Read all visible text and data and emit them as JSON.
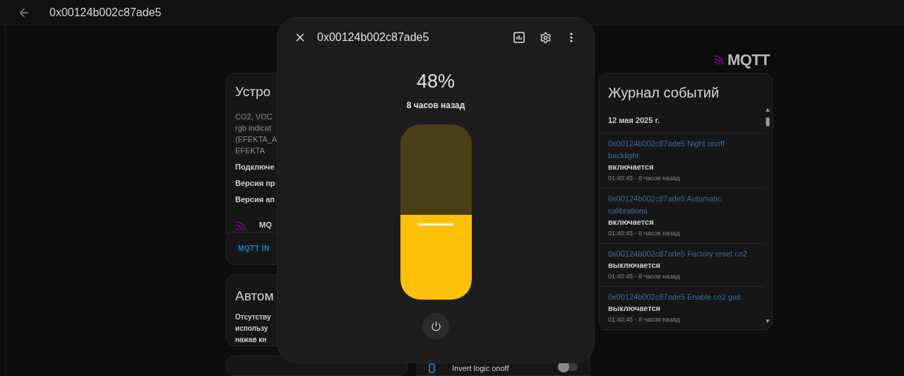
{
  "top_bar": {
    "title": "0x00124b002c87ade5"
  },
  "device_card": {
    "title": "Устро",
    "description_lines": [
      "CO2, VOC",
      "rgb indicat",
      "(EFEKTA_A",
      "EFEKTA"
    ],
    "info_lines": [
      "Подключе",
      "Версия пр",
      "Версия ап"
    ],
    "integration": "MQ",
    "action": "MQTT IN"
  },
  "automation_card": {
    "title": "Автом",
    "text_lines": [
      "Отсутству",
      "использу",
      "нажав кн"
    ]
  },
  "bottom_row": {
    "label": "Invert logic onoff",
    "on": false
  },
  "logo": {
    "text": "MQTT"
  },
  "logbook": {
    "title": "Журнал событий",
    "date": "12 мая 2025 г.",
    "entries": [
      {
        "name": "0x00124b002c87ade5 Night onoff backlight",
        "state": "включается",
        "time": "01:40:45 - 8 часов назад"
      },
      {
        "name": "0x00124b002c87ade5 Automatic calibrations",
        "state": "включается",
        "time": "01:40:45 - 8 часов назад"
      },
      {
        "name": "0x00124b002c87ade5 Factory reset co2",
        "state": "выключается",
        "time": "01:40:45 - 8 часов назад"
      },
      {
        "name": "0x00124b002c87ade5 Enable co2 gas",
        "state": "выключается",
        "time": "01:40:45 - 8 часов назад"
      }
    ]
  },
  "dialog": {
    "title": "0x00124b002c87ade5",
    "reading": "48%",
    "updated": "8 часов назад",
    "level": 0.48
  }
}
